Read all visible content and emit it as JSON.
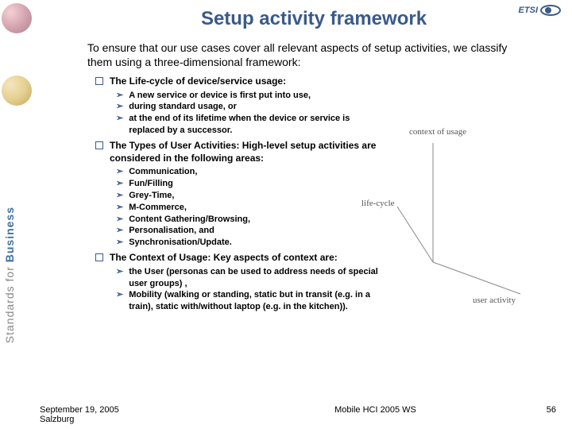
{
  "sidebar": {
    "vertical_text_1": "Standards",
    "vertical_text_2": " for ",
    "vertical_text_3": "Business"
  },
  "logo": {
    "text": "ETSI"
  },
  "title": "Setup activity framework",
  "intro": "To ensure that our use cases cover all relevant aspects of setup activities, we classify them using a three-dimensional framework:",
  "b1": {
    "text": "The Life-cycle of device/service usage:",
    "subs": [
      "A new service or device is first put into use,",
      "during standard usage, or",
      "at the end of its lifetime when the device or service is replaced by a successor."
    ]
  },
  "b2": {
    "text": "The Types of User Activities: High-level setup activities are considered in the following areas:",
    "subs": [
      "Communication,",
      "Fun/Filling",
      "Grey-Time,",
      "M-Commerce,",
      "Content Gathering/Browsing,",
      "Personalisation, and",
      "Synchronisation/Update."
    ]
  },
  "b3": {
    "text": "The Context of Usage: Key aspects of context are:",
    "subs": [
      "the User (personas can be used to address needs of special user groups) ,",
      "Mobility (walking or standing, static but in transit (e.g. in a train), static with/without laptop (e.g. in the kitchen))."
    ]
  },
  "diagram": {
    "axis1": "context of usage",
    "axis2": "life-cycle",
    "axis3": "user activity"
  },
  "footer": {
    "left1": "September 19, 2005",
    "left2": "Salzburg",
    "center": "Mobile HCI 2005 WS",
    "right": "56"
  }
}
